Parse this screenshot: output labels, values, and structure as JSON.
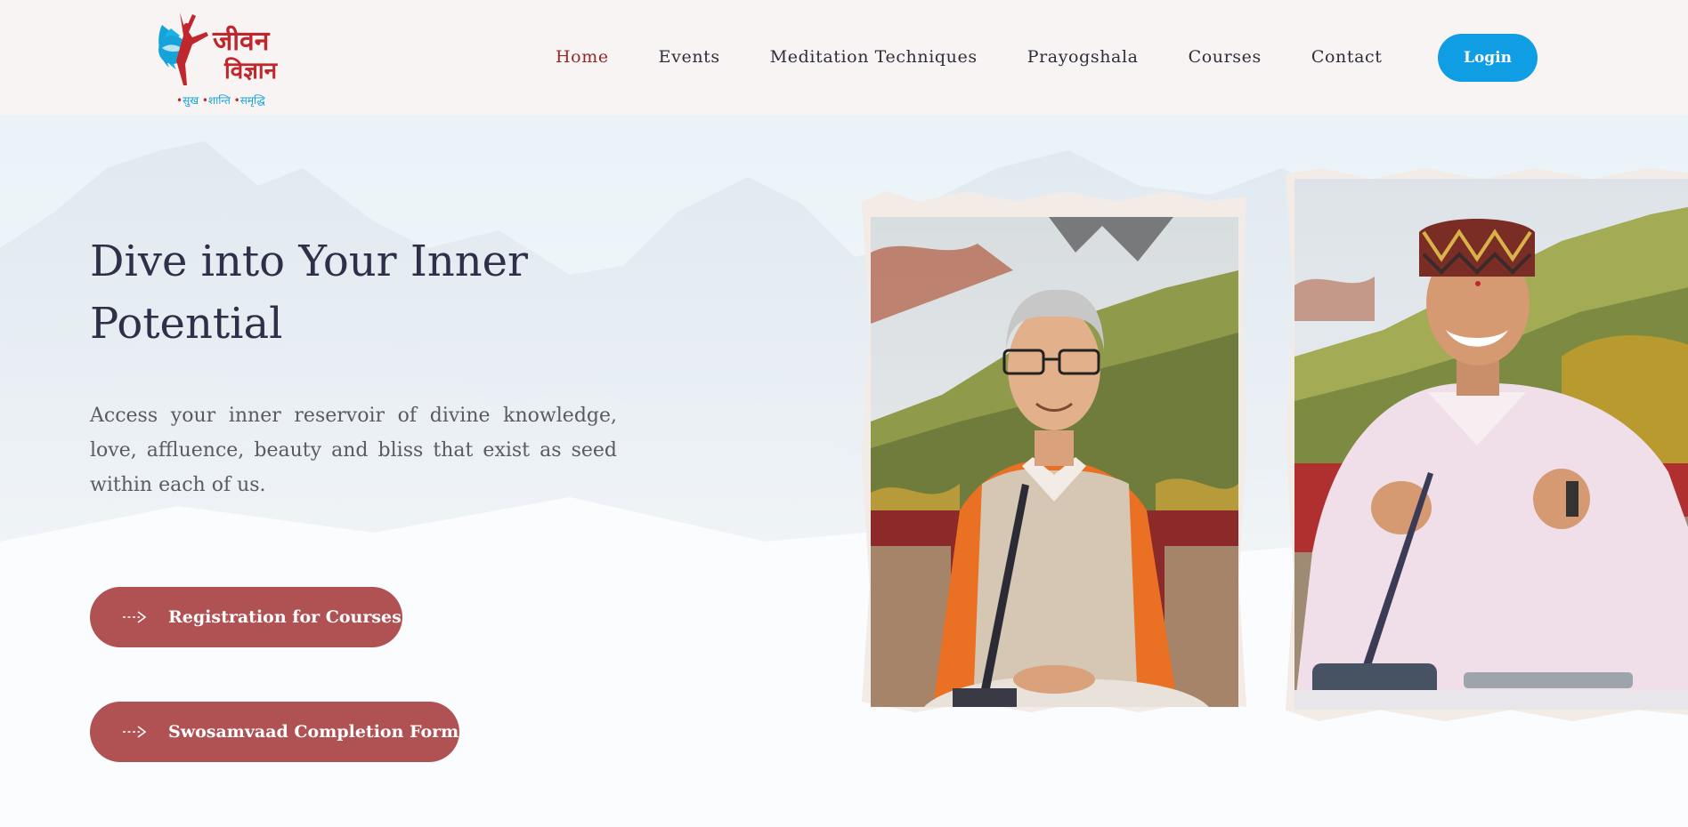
{
  "header": {
    "logo": {
      "word_line1": "जीवन",
      "word_line2": "विज्ञान",
      "tagline": [
        {
          "dot": "•",
          "text": "सुख"
        },
        {
          "dot": "•",
          "text": "शान्ति"
        },
        {
          "dot": "•",
          "text": "समृद्धि"
        }
      ]
    },
    "nav": [
      {
        "label": "Home",
        "active": true
      },
      {
        "label": "Events",
        "active": false
      },
      {
        "label": "Meditation Techniques",
        "active": false
      },
      {
        "label": "Prayogshala",
        "active": false
      },
      {
        "label": "Courses",
        "active": false
      },
      {
        "label": "Contact",
        "active": false
      }
    ],
    "login_label": "Login"
  },
  "hero": {
    "title_line1": "Dive into Your Inner",
    "title_line2": "Potential",
    "description": "Access your inner reservoir of divine knowledge, love, affluence, beauty and bliss that exist as seed within each of us.",
    "buttons": [
      {
        "label": "Registration for Courses",
        "icon": "dashed-arrow-icon"
      },
      {
        "label": "Swosamvaad Completion Form",
        "icon": "dashed-arrow-icon"
      }
    ],
    "photos": [
      {
        "name": "speaker-photo-1"
      },
      {
        "name": "speaker-photo-2"
      }
    ]
  },
  "colors": {
    "header_bg": "#f9f4f4",
    "nav_active": "#8f2b2b",
    "nav_text": "#2e2e38",
    "login_bg": "#0f9de3",
    "cta_bg": "#b05154",
    "title": "#2d3048",
    "body_text": "#5a5a63",
    "logo_red": "#c0272d",
    "logo_blue": "#16a3d9"
  }
}
